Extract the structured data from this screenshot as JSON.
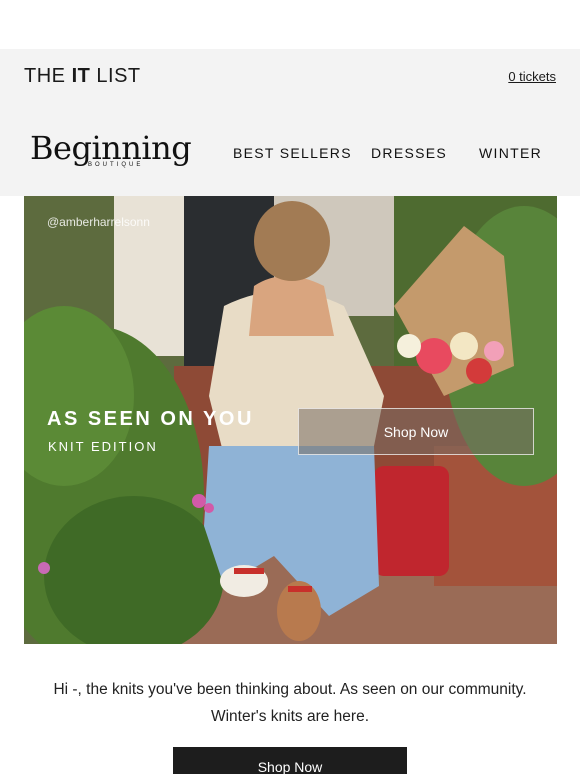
{
  "it_list": {
    "title_prefix": "THE ",
    "title_strong": "IT",
    "title_suffix": " LIST",
    "tickets_label": "0 tickets"
  },
  "brand": {
    "name": "Beginning",
    "sub": "BOUTIQUE"
  },
  "nav": {
    "items": [
      {
        "label": "BEST SELLERS"
      },
      {
        "label": "DRESSES"
      },
      {
        "label": "WINTER"
      }
    ]
  },
  "hero": {
    "handle": "@amberharrelsonn",
    "headline": "AS SEEN ON YOU",
    "subheadline": "KNIT EDITION",
    "button_label": "Shop Now"
  },
  "body": {
    "line1": "Hi -, the knits you've been thinking about. As seen on our community.",
    "line2": "Winter's knits are here."
  },
  "cta": {
    "label": "Shop Now"
  },
  "colors": {
    "bar_bg": "#f3f3f3",
    "cta_bg": "#1d1d1d",
    "text": "#1a1a1a"
  }
}
